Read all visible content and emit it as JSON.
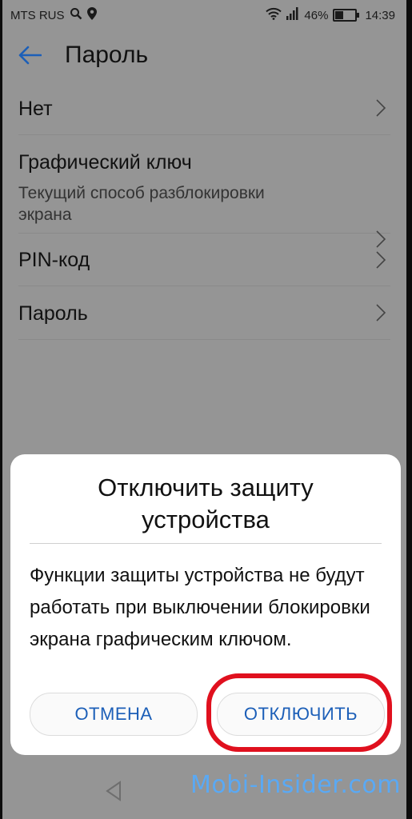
{
  "status_bar": {
    "carrier": "MTS RUS",
    "battery": "46%",
    "battery_level": 0.46,
    "time": "14:39",
    "icons": [
      "search-icon",
      "location-icon",
      "wifi-icon",
      "signal-icon",
      "battery-icon"
    ]
  },
  "header": {
    "back_icon": "arrow-left-icon",
    "title": "Пароль"
  },
  "list": {
    "items": [
      {
        "title": "Нет",
        "subtitle": ""
      },
      {
        "title": "Графический ключ",
        "subtitle": "Текущий способ разблокировки экрана"
      },
      {
        "title": "PIN-код",
        "subtitle": ""
      },
      {
        "title": "Пароль",
        "subtitle": ""
      }
    ],
    "chevron_icon": "chevron-right-icon"
  },
  "dialog": {
    "title": "Отключить защиту устройства",
    "message": "Функции защиты устройства не будут работать при выключении блокировки экрана графическим ключом.",
    "cancel_label": "ОТМЕНА",
    "confirm_label": "ОТКЛЮЧИТЬ"
  },
  "nav_bar": {
    "back_icon": "triangle-back-icon"
  },
  "watermark": "Mobi-Insider.com",
  "colors": {
    "accent": "#1c5fb8",
    "highlight": "#e0101e",
    "watermark": "#5aa9f4",
    "overlay_bg": "#959595"
  }
}
